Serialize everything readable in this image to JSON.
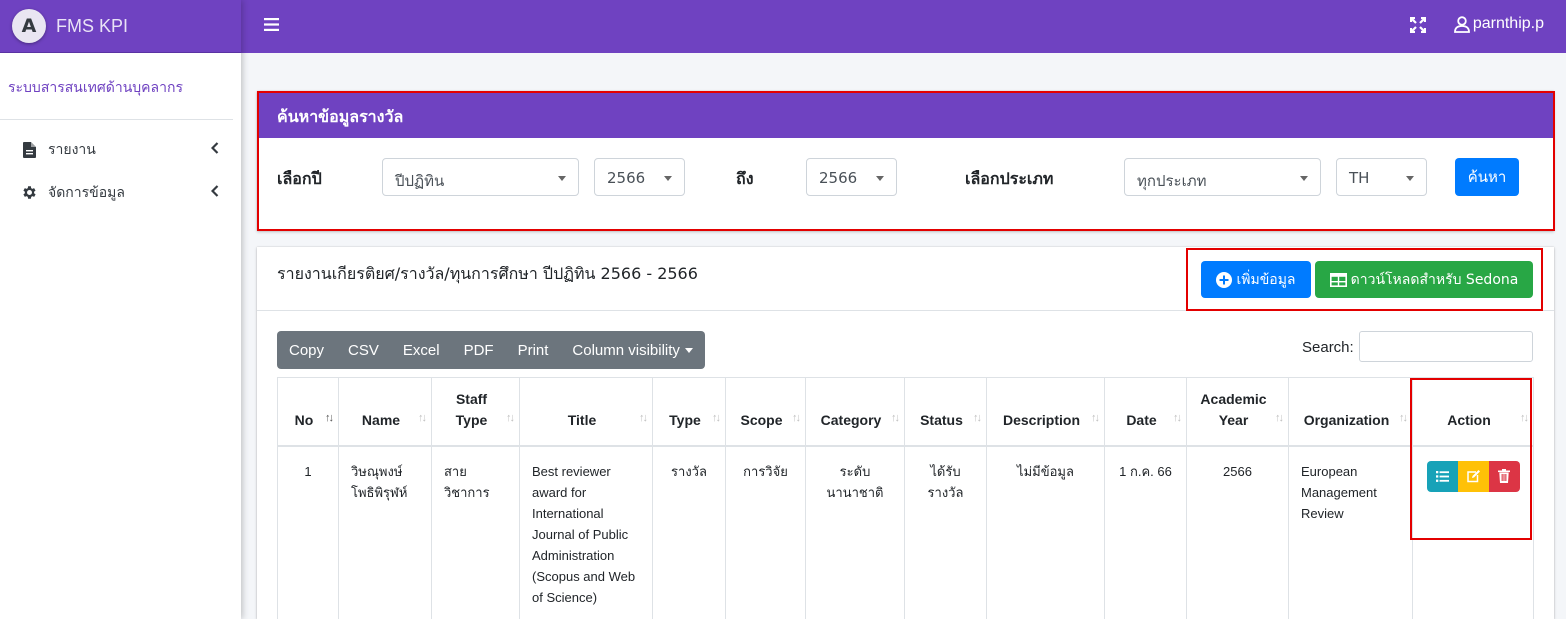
{
  "brand": {
    "logo_letter": "A",
    "name": "FMS KPI"
  },
  "navbar": {
    "username": "parnthip.p"
  },
  "sidebar": {
    "section_title": "ระบบสารสนเทศด้านบุคลากร",
    "items": [
      {
        "label": "รายงาน",
        "icon": "file-icon"
      },
      {
        "label": "จัดการข้อมูล",
        "icon": "gear-icon"
      }
    ]
  },
  "search": {
    "title": "ค้นหาข้อมูลรางวัล",
    "year_label": "เลือกปี",
    "year_type": "ปีปฏิทิน",
    "year_from": "2566",
    "to_label": "ถึง",
    "year_to": "2566",
    "type_label": "เลือกประเภท",
    "type_value": "ทุกประเภท",
    "lang_value": "TH",
    "search_button": "ค้นหา"
  },
  "report": {
    "title": "รายงานเกียรติยศ/รางวัล/ทุนการศึกษา ปีปฏิทิน 2566 - 2566",
    "add_button": "เพิ่มข้อมูล",
    "download_button": "ดาวน์โหลดสำหรับ Sedona",
    "export_buttons": [
      "Copy",
      "CSV",
      "Excel",
      "PDF",
      "Print",
      "Column visibility"
    ],
    "search_label": "Search:",
    "search_value": ""
  },
  "table": {
    "headers": [
      "No",
      "Name",
      "Staff\nType",
      "Title",
      "Type",
      "Scope",
      "Category",
      "Status",
      "Description",
      "Date",
      "Academic\nYear",
      "Organization",
      "Action"
    ],
    "rows": [
      {
        "no": "1",
        "name": "วิษณุพงษ์ โพธิพิรุฬห์",
        "staff_type": "สาย วิชาการ",
        "title": "Best reviewer award for International Journal of Public Administration (Scopus and Web of Science)",
        "type": "รางวัล",
        "scope": "การวิจัย",
        "category": "ระดับ นานาชาติ",
        "status": "ได้รับ รางวัล",
        "description": "ไม่มีข้อมูล",
        "date": "1 ก.ค. 66",
        "academic_year": "2566",
        "organization": "European Management Review"
      }
    ]
  },
  "colors": {
    "primary_purple": "#6f42c1",
    "primary_blue": "#007bff",
    "success_green": "#28a745",
    "info_teal": "#17a2b8",
    "warning_yellow": "#ffc107",
    "danger_red": "#dc3545",
    "highlight_red": "#e30000"
  }
}
